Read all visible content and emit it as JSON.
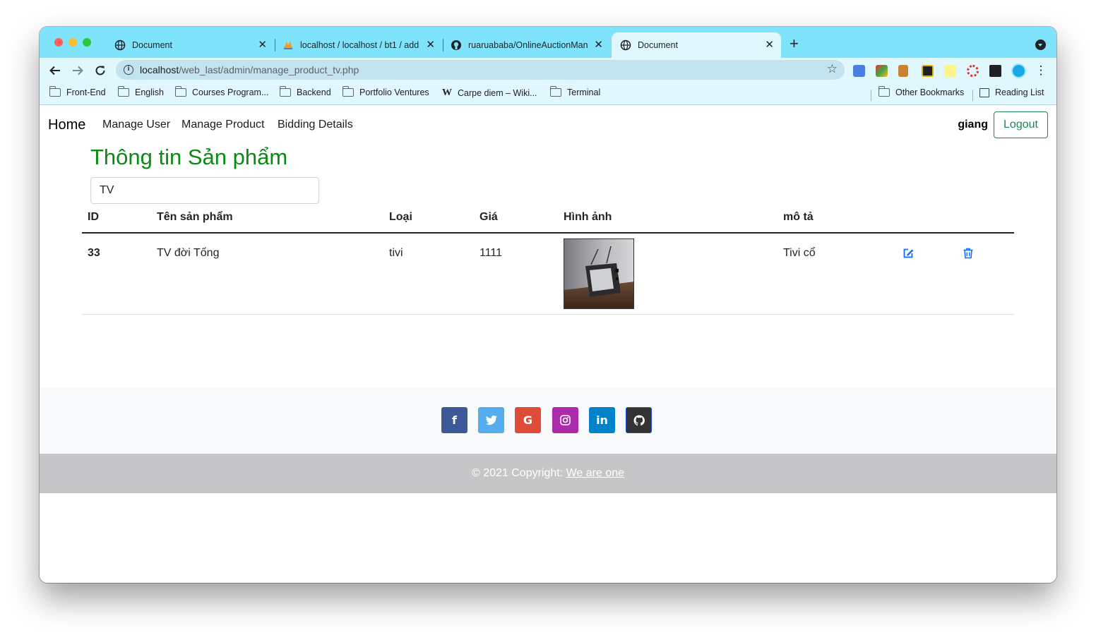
{
  "browser": {
    "tabs": [
      {
        "title": "Document",
        "favicon": "globe-icon",
        "active": false
      },
      {
        "title": "localhost / localhost / bt1 / add",
        "favicon": "phpmyadmin-icon",
        "active": false
      },
      {
        "title": "ruaruababa/OnlineAuctionMan",
        "favicon": "github-icon",
        "active": false
      },
      {
        "title": "Document",
        "favicon": "globe-icon",
        "active": true
      }
    ],
    "tab_close_glyph": "✕",
    "new_tab_glyph": "+",
    "url_host": "localhost",
    "url_path": "/web_last/admin/manage_product_tv.php",
    "bookmarks": [
      {
        "label": "Front-End",
        "icon": "folder-icon"
      },
      {
        "label": "English",
        "icon": "folder-icon"
      },
      {
        "label": "Courses Program...",
        "icon": "folder-icon"
      },
      {
        "label": "Backend",
        "icon": "folder-icon"
      },
      {
        "label": "Portfolio Ventures",
        "icon": "folder-icon"
      },
      {
        "label": "Carpe diem – Wiki...",
        "icon": "wikipedia-icon"
      },
      {
        "label": "Terminal",
        "icon": "folder-icon"
      }
    ],
    "other_bookmarks": "Other Bookmarks",
    "reading_list": "Reading List",
    "wiki_glyph": "W"
  },
  "navbar": {
    "brand": "Home",
    "links": [
      "Manage User",
      "Manage Product",
      "Bidding Details"
    ],
    "user": "giang",
    "logout": "Logout"
  },
  "main": {
    "title": "Thông tin Sản phẩm",
    "search_value": "TV",
    "table": {
      "headers": [
        "ID",
        "Tên sản phẩm",
        "Loại",
        "Giá",
        "Hình ảnh",
        "mô tả"
      ],
      "rows": [
        {
          "id": "33",
          "name": "TV đời Tống",
          "type": "tivi",
          "price": "1111",
          "image": "vintage-tv-photo",
          "description": "Tivi cổ"
        }
      ]
    }
  },
  "footer": {
    "social": [
      {
        "name": "facebook",
        "glyph": "f",
        "color": "#3b5998"
      },
      {
        "name": "twitter",
        "glyph": "🐦",
        "color": "#55acee"
      },
      {
        "name": "google",
        "glyph": "G",
        "color": "#dd4b39"
      },
      {
        "name": "instagram",
        "glyph": "◎",
        "color": "#ac2bac"
      },
      {
        "name": "linkedin",
        "glyph": "in",
        "color": "#0082ca"
      },
      {
        "name": "github",
        "glyph": "●",
        "color": "#333333"
      }
    ],
    "copyright_text": "© 2021 Copyright: ",
    "copyright_link": "We are one"
  }
}
